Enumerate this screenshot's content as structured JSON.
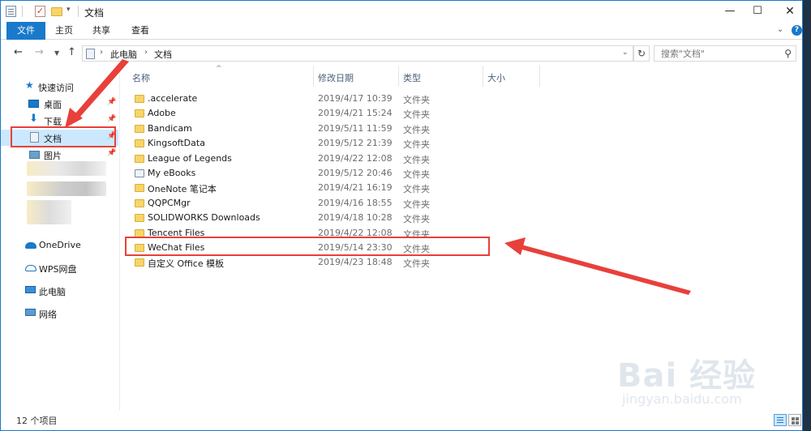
{
  "window": {
    "title": "文档"
  },
  "quick_access": {
    "dropdown": "▾"
  },
  "ribbon": {
    "tabs": [
      "文件",
      "主页",
      "共享",
      "查看"
    ]
  },
  "nav": {
    "path": [
      "此电脑",
      "文档"
    ],
    "search_placeholder": "搜索\"文档\"",
    "refresh": "↻"
  },
  "sidebar": {
    "items": [
      {
        "label": "快速访问",
        "icon": "star-icon"
      },
      {
        "label": "桌面",
        "icon": "desktop-icon",
        "pinned": true
      },
      {
        "label": "下载",
        "icon": "download-icon",
        "pinned": true
      },
      {
        "label": "文档",
        "icon": "document-icon",
        "pinned": true,
        "selected": true
      },
      {
        "label": "图片",
        "icon": "pictures-icon",
        "pinned": true
      },
      {
        "label": "OneDrive",
        "icon": "onedrive-icon"
      },
      {
        "label": "WPS网盘",
        "icon": "wps-cloud-icon"
      },
      {
        "label": "此电脑",
        "icon": "computer-icon"
      },
      {
        "label": "网络",
        "icon": "network-icon"
      }
    ]
  },
  "columns": {
    "name": "名称",
    "date": "修改日期",
    "type": "类型",
    "size": "大小"
  },
  "files": [
    {
      "name": ".accelerate",
      "date": "2019/4/17 10:39",
      "type": "文件夹"
    },
    {
      "name": "Adobe",
      "date": "2019/4/21 15:24",
      "type": "文件夹"
    },
    {
      "name": "Bandicam",
      "date": "2019/5/11 11:59",
      "type": "文件夹"
    },
    {
      "name": "KingsoftData",
      "date": "2019/5/12 21:39",
      "type": "文件夹"
    },
    {
      "name": "League of Legends",
      "date": "2019/4/22 12:08",
      "type": "文件夹"
    },
    {
      "name": "My eBooks",
      "date": "2019/5/12 20:46",
      "type": "文件夹"
    },
    {
      "name": "OneNote 笔记本",
      "date": "2019/4/21 16:19",
      "type": "文件夹"
    },
    {
      "name": "QQPCMgr",
      "date": "2019/4/16 18:55",
      "type": "文件夹"
    },
    {
      "name": "SOLIDWORKS Downloads",
      "date": "2019/4/18 10:28",
      "type": "文件夹"
    },
    {
      "name": "Tencent Files",
      "date": "2019/4/22 12:08",
      "type": "文件夹"
    },
    {
      "name": "WeChat Files",
      "date": "2019/5/14 23:30",
      "type": "文件夹"
    },
    {
      "name": "自定义 Office 模板",
      "date": "2019/4/23 18:48",
      "type": "文件夹"
    }
  ],
  "status": {
    "count": "12 个项目"
  },
  "watermark": {
    "logo": "Bai 经验",
    "url": "jingyan.baidu.com"
  },
  "colors": {
    "accent": "#1979ca",
    "annotation": "#e8403a",
    "folder": "#f7d569"
  }
}
